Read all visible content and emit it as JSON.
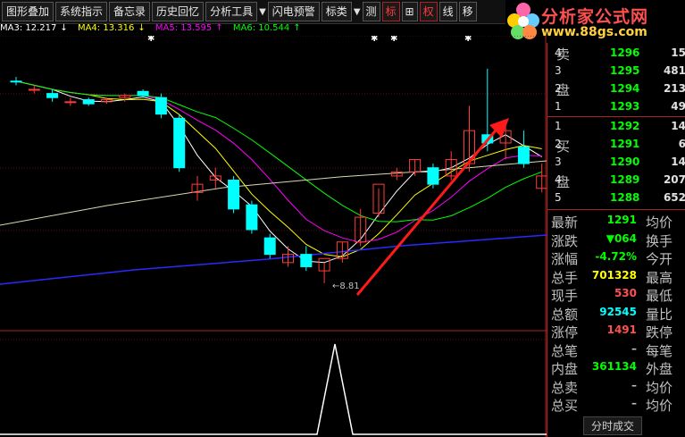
{
  "toolbar": {
    "buttons": [
      "图形叠加",
      "系统指示",
      "备忘录",
      "历史回忆",
      "分析工具",
      "闪电预警",
      "标类"
    ],
    "small_buttons": [
      "测",
      "标",
      "⊞",
      "权",
      "线",
      "移"
    ]
  },
  "logo": {
    "title": "分析家公式网",
    "url": "www.88gs.com"
  },
  "ma": [
    {
      "label": "MA3: 12.217",
      "arrow": "↓",
      "color": "#ffffff"
    },
    {
      "label": "MA4: 13.316",
      "arrow": "↓",
      "color": "#ffff00"
    },
    {
      "label": "MA5: 13.595",
      "arrow": "↑",
      "color": "#ff00ff"
    },
    {
      "label": "MA6: 10.544",
      "arrow": "↑",
      "color": "#00ff00"
    }
  ],
  "chart_data": {
    "type": "candlestick",
    "annotation_low": "←8.81",
    "candles": [
      {
        "o": 12.9,
        "h": 13.0,
        "c": 12.9,
        "l": 12.8,
        "up": false
      },
      {
        "o": 12.7,
        "h": 12.8,
        "c": 12.7,
        "l": 12.6,
        "up": true
      },
      {
        "o": 12.6,
        "h": 12.7,
        "c": 12.5,
        "l": 12.4,
        "up": false
      },
      {
        "o": 12.4,
        "h": 12.5,
        "c": 12.4,
        "l": 12.3,
        "up": true
      },
      {
        "o": 12.45,
        "h": 12.5,
        "c": 12.35,
        "l": 12.3,
        "up": false
      },
      {
        "o": 12.4,
        "h": 12.5,
        "c": 12.45,
        "l": 12.35,
        "up": true
      },
      {
        "o": 12.5,
        "h": 12.6,
        "c": 12.55,
        "l": 12.4,
        "up": true
      },
      {
        "o": 12.65,
        "h": 12.7,
        "c": 12.55,
        "l": 12.5,
        "up": false
      },
      {
        "o": 12.5,
        "h": 12.6,
        "c": 12.1,
        "l": 12.0,
        "up": false
      },
      {
        "o": 12.0,
        "h": 12.1,
        "c": 10.8,
        "l": 10.7,
        "up": false
      },
      {
        "o": 10.2,
        "h": 10.6,
        "c": 10.4,
        "l": 10.0,
        "up": true
      },
      {
        "o": 10.6,
        "h": 10.8,
        "c": 10.5,
        "l": 10.3,
        "up": true
      },
      {
        "o": 10.5,
        "h": 10.6,
        "c": 9.8,
        "l": 9.7,
        "up": false
      },
      {
        "o": 9.9,
        "h": 10.0,
        "c": 9.3,
        "l": 9.2,
        "up": false
      },
      {
        "o": 9.1,
        "h": 9.2,
        "c": 8.7,
        "l": 8.6,
        "up": false
      },
      {
        "o": 8.7,
        "h": 8.9,
        "c": 8.5,
        "l": 8.4,
        "up": true
      },
      {
        "o": 8.7,
        "h": 8.9,
        "c": 8.4,
        "l": 8.3,
        "up": false
      },
      {
        "o": 8.3,
        "h": 8.5,
        "c": 8.6,
        "l": 8.0,
        "up": true
      },
      {
        "o": 8.6,
        "h": 9.0,
        "c": 9.0,
        "l": 8.5,
        "up": true
      },
      {
        "o": 9.0,
        "h": 9.8,
        "c": 9.6,
        "l": 8.9,
        "up": true
      },
      {
        "o": 9.7,
        "h": 10.3,
        "c": 10.4,
        "l": 9.6,
        "up": true
      },
      {
        "o": 10.6,
        "h": 10.8,
        "c": 10.7,
        "l": 10.5,
        "up": true
      },
      {
        "o": 10.7,
        "h": 11.0,
        "c": 11.0,
        "l": 10.6,
        "up": true
      },
      {
        "o": 10.8,
        "h": 10.9,
        "c": 10.4,
        "l": 10.3,
        "up": false
      },
      {
        "o": 10.6,
        "h": 11.2,
        "c": 11.0,
        "l": 10.5,
        "up": true
      },
      {
        "o": 10.9,
        "h": 12.3,
        "c": 11.7,
        "l": 10.7,
        "up": true
      },
      {
        "o": 11.6,
        "h": 13.2,
        "c": 11.4,
        "l": 11.2,
        "up": false
      },
      {
        "o": 11.4,
        "h": 11.9,
        "c": 11.7,
        "l": 11.0,
        "up": true
      },
      {
        "o": 11.3,
        "h": 11.7,
        "c": 10.9,
        "l": 10.8,
        "up": false
      },
      {
        "o": 10.3,
        "h": 10.9,
        "c": 10.6,
        "l": 10.2,
        "up": true
      }
    ],
    "ylim": [
      7.5,
      14.0
    ]
  },
  "orderbook": {
    "sell_label": [
      "卖",
      "盘"
    ],
    "buy_label": [
      "买",
      "盘"
    ],
    "sell": [
      {
        "idx": "4",
        "price": "1296",
        "vol": "15"
      },
      {
        "idx": "3",
        "price": "1295",
        "vol": "481"
      },
      {
        "idx": "2",
        "price": "1294",
        "vol": "213"
      },
      {
        "idx": "1",
        "price": "1293",
        "vol": "49"
      }
    ],
    "buy": [
      {
        "idx": "1",
        "price": "1292",
        "vol": "14"
      },
      {
        "idx": "2",
        "price": "1291",
        "vol": "6"
      },
      {
        "idx": "3",
        "price": "1290",
        "vol": "14"
      },
      {
        "idx": "4",
        "price": "1289",
        "vol": "207"
      },
      {
        "idx": "5",
        "price": "1288",
        "vol": "652"
      }
    ]
  },
  "stats": [
    {
      "label": "最新",
      "value": "1291",
      "color": "#00ff00",
      "right": "均价"
    },
    {
      "label": "涨跌",
      "value": "▼064",
      "color": "#00ff00",
      "right": "换手"
    },
    {
      "label": "涨幅",
      "value": "-4.72%",
      "color": "#00ff00",
      "right": "今开"
    },
    {
      "label": "总手",
      "value": "701328",
      "color": "#ffff00",
      "right": "最高"
    },
    {
      "label": "现手",
      "value": "530",
      "color": "#ff5050",
      "right": "最低"
    },
    {
      "label": "总额",
      "value": "92545",
      "color": "#00ffff",
      "right": "量比"
    },
    {
      "label": "涨停",
      "value": "1491",
      "color": "#ff5050",
      "right": "跌停"
    },
    {
      "label": "总笔",
      "value": "–",
      "color": "#c0c0c0",
      "right": "每笔"
    },
    {
      "label": "内盘",
      "value": "361134",
      "color": "#00ff00",
      "right": "外盘"
    },
    {
      "label": "总卖",
      "value": "–",
      "color": "#c0c0c0",
      "right": "均价"
    },
    {
      "label": "总买",
      "value": "–",
      "color": "#c0c0c0",
      "right": "均价"
    }
  ],
  "bottom_button": "分时成交"
}
